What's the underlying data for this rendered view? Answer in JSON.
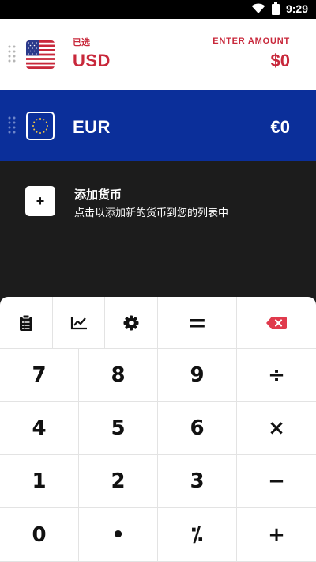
{
  "status_bar": {
    "time": "9:29",
    "icons": [
      "wifi-icon",
      "battery-icon"
    ]
  },
  "currencies": [
    {
      "code": "USD",
      "sub_label": "已选",
      "hint": "ENTER AMOUNT",
      "amount": "$0",
      "flag": "us-flag-icon",
      "background": "#ffffff",
      "text_color": "#c8283b"
    },
    {
      "code": "EUR",
      "amount": "€0",
      "flag": "eu-flag-icon",
      "background": "#0b2f9a",
      "text_color": "#ffffff"
    }
  ],
  "add_currency": {
    "button_label": "+",
    "title": "添加货币",
    "description": "点击以添加新的货币到您的列表中"
  },
  "toolbar": [
    {
      "name": "clipboard-icon"
    },
    {
      "name": "chart-icon"
    },
    {
      "name": "gear-icon"
    },
    {
      "name": "equals-icon",
      "label": "="
    },
    {
      "name": "backspace-icon",
      "color": "#e03a4c"
    }
  ],
  "keys": [
    [
      "7",
      "8",
      "9",
      "÷"
    ],
    [
      "4",
      "5",
      "6",
      "×"
    ],
    [
      "1",
      "2",
      "3",
      "−"
    ],
    [
      "0",
      "•",
      "⁒",
      "+"
    ]
  ],
  "colors": {
    "dark_bg": "#1c1c1c",
    "usd_accent": "#c8283b",
    "eur_bg": "#0b2f9a",
    "backspace": "#e03a4c"
  }
}
